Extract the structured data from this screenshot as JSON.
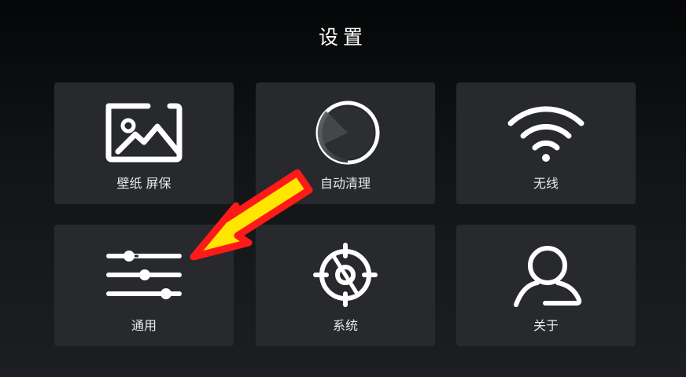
{
  "header": {
    "title": "设置"
  },
  "tiles": [
    {
      "label": "壁纸 屏保",
      "icon": "wallpaper-icon"
    },
    {
      "label": "自动清理",
      "icon": "cleanup-icon"
    },
    {
      "label": "无线",
      "icon": "wifi-icon"
    },
    {
      "label": "通用",
      "icon": "sliders-icon"
    },
    {
      "label": "系统",
      "icon": "system-wheel-icon"
    },
    {
      "label": "关于",
      "icon": "user-icon"
    }
  ],
  "annotation": {
    "icon": "arrow-annotation-icon",
    "color": "#ffe600",
    "outline": "#ff1a1a"
  },
  "colors": {
    "tile": "#27292c",
    "text": "#ffffff"
  }
}
